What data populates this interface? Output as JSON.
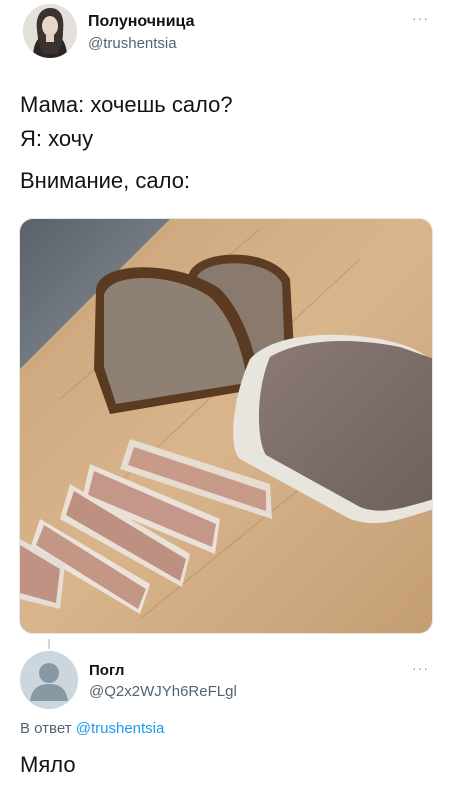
{
  "tweet": {
    "author_name": "Полуночница",
    "author_handle": "@trushentsia",
    "more_label": "···",
    "lines": [
      "Мама: хочешь сало?",
      "Я: хочу",
      "Внимание, сало:"
    ]
  },
  "reply": {
    "author_name": "Погл",
    "author_handle": "@Q2x2WJYh6ReFLgl",
    "more_label": "···",
    "reply_prefix": "В ответ",
    "reply_mention": "@trushentsia",
    "text": "Мяло"
  }
}
